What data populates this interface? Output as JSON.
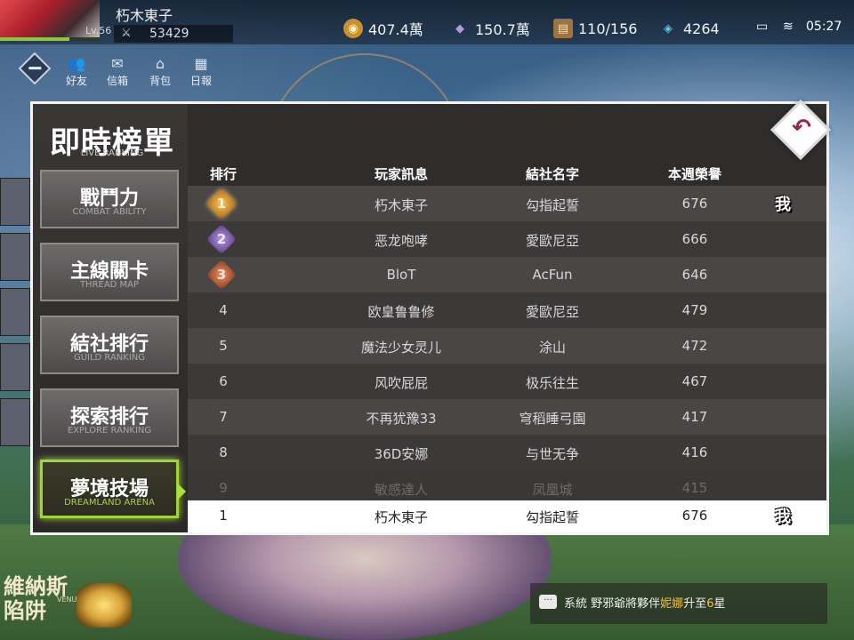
{
  "topbar": {
    "player_name": "朽木東子",
    "level": "Lv.56",
    "combat_power": "53429",
    "gold": "407.4萬",
    "crystals": "150.7萬",
    "inventory": "110/156",
    "diamonds": "4264",
    "time": "05:27"
  },
  "nav": {
    "friends": "好友",
    "mail": "信箱",
    "bag": "背包",
    "daily": "日報"
  },
  "panel": {
    "title": "即時榜單",
    "subtitle": "LIVE RANKING",
    "tabs": [
      {
        "label": "戰鬥力",
        "sub": "COMBAT ABILITY"
      },
      {
        "label": "主線關卡",
        "sub": "THREAD MAP"
      },
      {
        "label": "結社排行",
        "sub": "GUILD RANKING"
      },
      {
        "label": "探索排行",
        "sub": "EXPLORE RANKING"
      },
      {
        "label": "夢境技場",
        "sub": "DREAMLAND ARENA"
      }
    ],
    "headers": {
      "rank": "排行",
      "player": "玩家訊息",
      "guild": "結社名字",
      "honor": "本週榮譽"
    },
    "me_tag": "我",
    "rows": [
      {
        "rank": "1",
        "player": "朽木東子",
        "guild": "勾指起誓",
        "honor": "676"
      },
      {
        "rank": "2",
        "player": "恶龙咆哮",
        "guild": "愛歐尼亞",
        "honor": "666"
      },
      {
        "rank": "3",
        "player": "BloT",
        "guild": "AcFun",
        "honor": "646"
      },
      {
        "rank": "4",
        "player": "欧皇鲁鲁修",
        "guild": "愛歐尼亞",
        "honor": "479"
      },
      {
        "rank": "5",
        "player": "魔法少女灵儿",
        "guild": "涂山",
        "honor": "472"
      },
      {
        "rank": "6",
        "player": "风吹屁屁",
        "guild": "极乐往生",
        "honor": "467"
      },
      {
        "rank": "7",
        "player": "不再犹豫33",
        "guild": "穹稻睡弓園",
        "honor": "417"
      },
      {
        "rank": "8",
        "player": "36D安娜",
        "guild": "与世无争",
        "honor": "416"
      },
      {
        "rank": "9",
        "player": "敏感達人",
        "guild": "凤凰城",
        "honor": "415"
      }
    ],
    "self_row": {
      "rank": "1",
      "player": "朽木東子",
      "guild": "勾指起誓",
      "honor": "676"
    }
  },
  "back_button_icon": "back-arrow-icon",
  "logo": {
    "line1": "維納斯",
    "line2": "VENUS TRAP",
    "line3": "陷阱"
  },
  "chat": {
    "icon": "chat-bubble-icon",
    "prefix": "系統",
    "text1": "野邪爺將夥伴",
    "highlight1": "妮娜",
    "text2": "升至",
    "highlight2": "6",
    "text3": "星"
  },
  "colors": {
    "active_tab_border": "#9fd43a",
    "panel_bg": "#2f2c2c",
    "row_light": "#4a4646",
    "row_dark": "#3c3939",
    "gold_medal": "#f7c861",
    "silver_medal": "#b59ad9",
    "bronze_medal": "#e69466",
    "chat_highlight": "#f5c244"
  }
}
